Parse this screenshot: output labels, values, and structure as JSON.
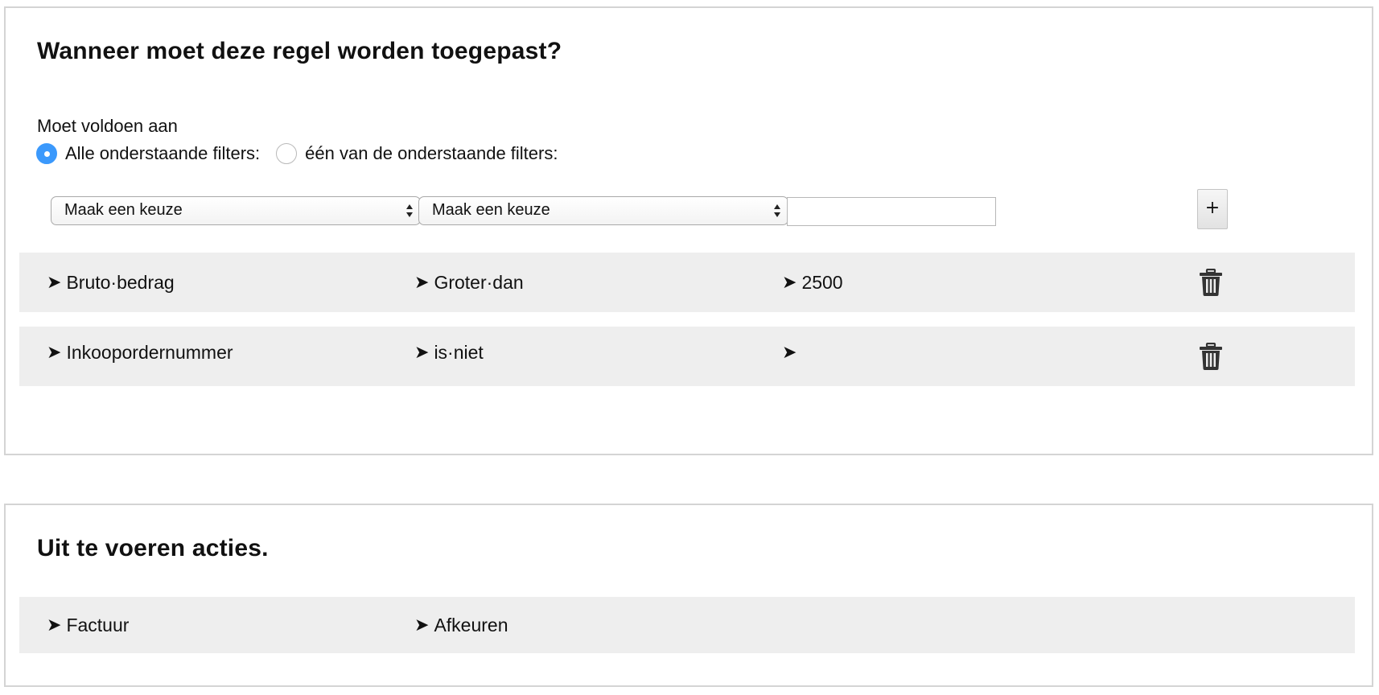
{
  "conditions": {
    "title": "Wanneer moet deze regel worden toegepast?",
    "match_label": "Moet voldoen aan",
    "match_options": [
      {
        "label": "Alle onderstaande filters:",
        "selected": true
      },
      {
        "label": "één van de onderstaande filters:",
        "selected": false
      }
    ],
    "new_filter": {
      "field_select": "Maak een keuze",
      "operator_select": "Maak een keuze",
      "value_input": "",
      "add_label": "+"
    },
    "filters": [
      {
        "field": "Bruto·bedrag",
        "operator": "Groter·dan",
        "value": "2500"
      },
      {
        "field": "Inkoopordernummer",
        "operator": "is·niet",
        "value": ""
      }
    ]
  },
  "actions": {
    "title": "Uit te voeren acties.",
    "items": [
      {
        "target": "Factuur",
        "action": "Afkeuren"
      }
    ]
  },
  "colors": {
    "accent": "#3b99fc",
    "row_background": "#eeeeee",
    "border": "#d4d4d4"
  },
  "icons": {
    "bullet": "arrow-right-icon",
    "delete": "trash-icon",
    "select": "select-arrows-icon"
  }
}
